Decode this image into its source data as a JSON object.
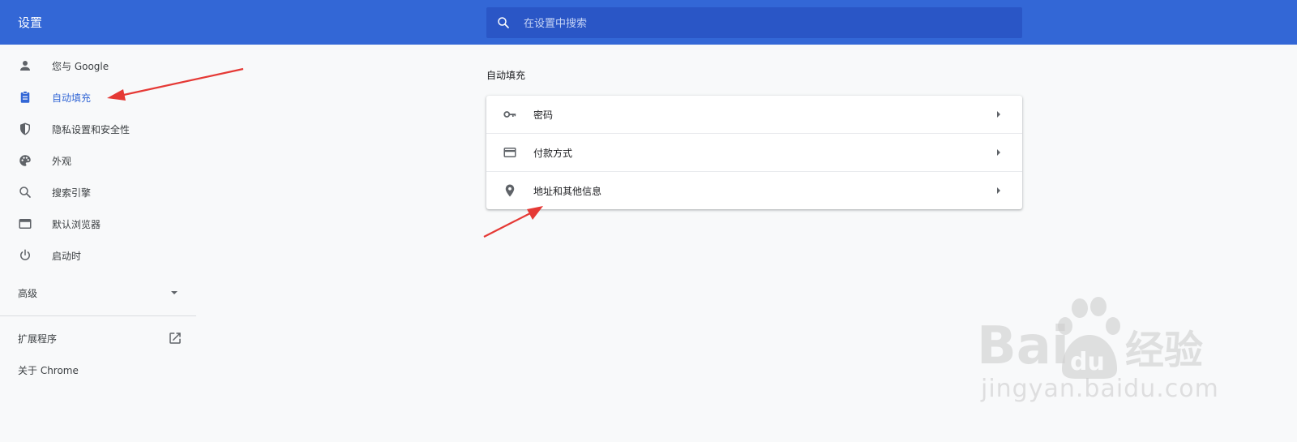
{
  "header": {
    "title": "设置",
    "search_placeholder": "在设置中搜索",
    "search_icon": "search-icon"
  },
  "sidebar": {
    "items": [
      {
        "label": "您与 Google",
        "icon": "person-icon"
      },
      {
        "label": "自动填充",
        "icon": "clipboard-icon",
        "active": true
      },
      {
        "label": "隐私设置和安全性",
        "icon": "shield-icon"
      },
      {
        "label": "外观",
        "icon": "palette-icon"
      },
      {
        "label": "搜索引擎",
        "icon": "search-icon"
      },
      {
        "label": "默认浏览器",
        "icon": "browser-icon"
      },
      {
        "label": "启动时",
        "icon": "power-icon"
      }
    ],
    "advanced_label": "高级",
    "extensions_label": "扩展程序",
    "about_label": "关于 Chrome"
  },
  "main": {
    "section_title": "自动填充",
    "rows": [
      {
        "label": "密码",
        "icon": "key-icon"
      },
      {
        "label": "付款方式",
        "icon": "credit-card-icon"
      },
      {
        "label": "地址和其他信息",
        "icon": "location-pin-icon"
      }
    ]
  },
  "watermark": {
    "text": "jingyan.baidu.com",
    "logo_text": "Baidu经验"
  },
  "colors": {
    "header_bg": "#3367d6",
    "search_bg": "#2a56c6",
    "active_text": "#3367d6",
    "page_bg": "#f8f9fa",
    "annotation_arrow": "#e53935"
  }
}
